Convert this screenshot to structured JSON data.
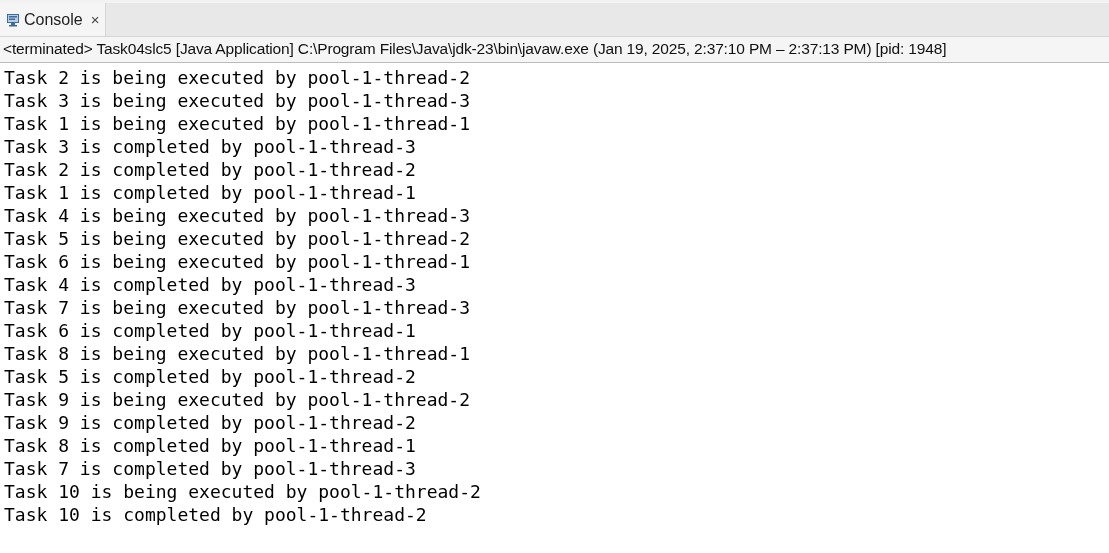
{
  "tabs": [
    {
      "label": "Console",
      "selected": true,
      "close": "×"
    }
  ],
  "status": "<terminated> Task04slc5 [Java Application] C:\\Program Files\\Java\\jdk-23\\bin\\javaw.exe  (Jan 19, 2025, 2:37:10 PM – 2:37:13 PM) [pid: 1948]",
  "output": [
    "Task 2 is being executed by pool-1-thread-2",
    "Task 3 is being executed by pool-1-thread-3",
    "Task 1 is being executed by pool-1-thread-1",
    "Task 3 is completed by pool-1-thread-3",
    "Task 2 is completed by pool-1-thread-2",
    "Task 1 is completed by pool-1-thread-1",
    "Task 4 is being executed by pool-1-thread-3",
    "Task 5 is being executed by pool-1-thread-2",
    "Task 6 is being executed by pool-1-thread-1",
    "Task 4 is completed by pool-1-thread-3",
    "Task 7 is being executed by pool-1-thread-3",
    "Task 6 is completed by pool-1-thread-1",
    "Task 8 is being executed by pool-1-thread-1",
    "Task 5 is completed by pool-1-thread-2",
    "Task 9 is being executed by pool-1-thread-2",
    "Task 9 is completed by pool-1-thread-2",
    "Task 8 is completed by pool-1-thread-1",
    "Task 7 is completed by pool-1-thread-3",
    "Task 10 is being executed by pool-1-thread-2",
    "Task 10 is completed by pool-1-thread-2"
  ]
}
